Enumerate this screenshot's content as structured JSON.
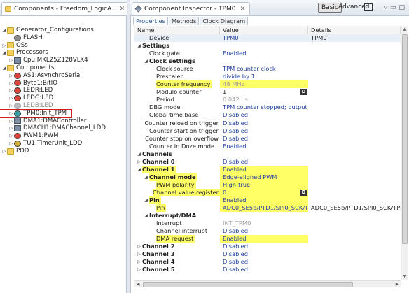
{
  "left": {
    "tab_title": "Components - Freedom_LogicA...",
    "tab_close": "✕",
    "win_buttons": [
      "▭",
      "□"
    ],
    "tree": [
      {
        "level": 0,
        "twisty": "◢",
        "icon": "folder",
        "label": "Generator_Configurations",
        "name": "tree-item-generator-configurations"
      },
      {
        "level": 1,
        "twisty": "",
        "icon": "gear-s",
        "label": "FLASH",
        "name": "tree-item-flash"
      },
      {
        "level": 0,
        "twisty": "▷",
        "icon": "folder",
        "label": "OSs",
        "name": "tree-item-oss"
      },
      {
        "level": 0,
        "twisty": "◢",
        "icon": "folder",
        "label": "Processors",
        "name": "tree-item-processors"
      },
      {
        "level": 1,
        "twisty": "▷",
        "icon": "chip",
        "label": "Cpu:MKL25Z128VLK4",
        "name": "tree-item-cpu"
      },
      {
        "level": 0,
        "twisty": "◢",
        "icon": "folder",
        "label": "Components",
        "name": "tree-item-components"
      },
      {
        "level": 1,
        "twisty": "▷",
        "icon": "cog-red",
        "label": "AS1:AsynchroSerial",
        "name": "tree-item-as1"
      },
      {
        "level": 1,
        "twisty": "▷",
        "icon": "cog-red",
        "label": "Byte1:BitIO",
        "name": "tree-item-byte1"
      },
      {
        "level": 1,
        "twisty": "▷",
        "icon": "cog-red",
        "label": "LEDR:LED",
        "name": "tree-item-ledr"
      },
      {
        "level": 1,
        "twisty": "▷",
        "icon": "cog-red",
        "label": "LEDG:LED",
        "name": "tree-item-ledg"
      },
      {
        "level": 1,
        "twisty": "▷",
        "icon": "cog-gray",
        "label": "LEDB:LED",
        "name": "tree-item-ledb",
        "dim": true
      },
      {
        "level": 1,
        "twisty": "▷",
        "icon": "cog-teal",
        "label": "TPM0:Init_TPM",
        "name": "tree-item-tpm0",
        "selected": true
      },
      {
        "level": 1,
        "twisty": "▷",
        "icon": "chip",
        "label": "DMA1:DMAController",
        "name": "tree-item-dma1"
      },
      {
        "level": 1,
        "twisty": "▷",
        "icon": "chip",
        "label": "DMACH1:DMAChannel_LDD",
        "name": "tree-item-dmach1"
      },
      {
        "level": 1,
        "twisty": "▷",
        "icon": "cog-red",
        "label": "PWM1:PWM",
        "name": "tree-item-pwm1"
      },
      {
        "level": 1,
        "twisty": "▷",
        "icon": "cog-yellow",
        "label": "TU1:TimerUnit_LDD",
        "name": "tree-item-tu1"
      },
      {
        "level": 0,
        "twisty": "▷",
        "icon": "folder",
        "label": "PDD",
        "name": "tree-item-pdd"
      }
    ]
  },
  "right": {
    "tab_title": "Component Inspector - TPM0",
    "tab_close": "✕",
    "basic_label": "Basic",
    "advanced_label": "Advanced",
    "win_buttons": [
      "▿",
      "▭",
      "□"
    ],
    "prop_tabs": [
      "Properties",
      "Methods",
      "Clock Diagram"
    ],
    "columns": [
      "Name",
      "Value",
      "Details"
    ],
    "rows": [
      {
        "i": 1,
        "tri": "",
        "name": "Device",
        "value": "TPM0",
        "details": "TPM0",
        "selected": true
      },
      {
        "i": 0,
        "tri": "◢",
        "name": "Settings",
        "value": "",
        "details": "",
        "bold": true
      },
      {
        "i": 1,
        "tri": "",
        "name": "Clock gate",
        "value": "Enabled",
        "details": ""
      },
      {
        "i": 1,
        "tri": "◢",
        "name": "Clock settings",
        "value": "",
        "details": "",
        "bold": true
      },
      {
        "i": 2,
        "tri": "",
        "name": "Clock source",
        "value": "TPM counter clock",
        "details": ""
      },
      {
        "i": 2,
        "tri": "",
        "name": "Prescaler",
        "value": "divide by 1",
        "details": ""
      },
      {
        "i": 2,
        "tri": "",
        "name": "Counter frequency",
        "value": "48 MHz",
        "details": "",
        "hl": true,
        "gray": true
      },
      {
        "i": 2,
        "tri": "",
        "name": "Modulo counter",
        "value": "1",
        "details": "",
        "dbtn": true,
        "dark": true
      },
      {
        "i": 2,
        "tri": "",
        "name": "Period",
        "value": "0.042 us",
        "details": "",
        "gray": true
      },
      {
        "i": 1,
        "tri": "",
        "name": "DBG mode",
        "value": "TPM counter stopped; output pins ...",
        "details": ""
      },
      {
        "i": 1,
        "tri": "",
        "name": "Global time base",
        "value": "Disabled",
        "details": ""
      },
      {
        "i": 1,
        "tri": "",
        "name": "Counter reload on trigger",
        "value": "Disabled",
        "details": ""
      },
      {
        "i": 1,
        "tri": "",
        "name": "Counter start on trigger",
        "value": "Disabled",
        "details": ""
      },
      {
        "i": 1,
        "tri": "",
        "name": "Counter stop on overflow",
        "value": "Disabled",
        "details": ""
      },
      {
        "i": 1,
        "tri": "",
        "name": "Counter in Doze mode",
        "value": "Enabled",
        "details": ""
      },
      {
        "i": 0,
        "tri": "◢",
        "name": "Channels",
        "value": "",
        "details": "",
        "bold": true
      },
      {
        "i": 0,
        "tri": "▷",
        "name": "Channel 0",
        "value": "Disabled",
        "details": "",
        "bold": true
      },
      {
        "i": 0,
        "tri": "◢",
        "name": "Channel 1",
        "value": "Enabled",
        "details": "",
        "bold": true,
        "hl": true
      },
      {
        "i": 1,
        "tri": "◢",
        "name": "Channel mode",
        "value": "Edge-aligned PWM",
        "details": "",
        "bold": true,
        "hl": true
      },
      {
        "i": 2,
        "tri": "",
        "name": "PWM polarity",
        "value": "High-true",
        "details": "",
        "hl": true
      },
      {
        "i": 2,
        "tri": "",
        "name": "Channel value register",
        "value": "0",
        "details": "",
        "hl": true,
        "dbtn": true
      },
      {
        "i": 1,
        "tri": "◢",
        "name": "Pin",
        "value": "Enabled",
        "details": "",
        "bold": true,
        "hl": true
      },
      {
        "i": 2,
        "tri": "",
        "name": "Pin",
        "value": "ADC0_SE5b/PTD1/SPI0_SCK/TPM0_...",
        "details": "ADC0_SE5b/PTD1/SPI0_SCK/TPM0_...",
        "hl": true
      },
      {
        "i": 1,
        "tri": "◢",
        "name": "Interrupt/DMA",
        "value": "",
        "details": "",
        "bold": true
      },
      {
        "i": 2,
        "tri": "",
        "name": "Interrupt",
        "value": "INT_TPM0",
        "details": "",
        "gray": true
      },
      {
        "i": 2,
        "tri": "",
        "name": "Channel interrupt",
        "value": "Disabled",
        "details": ""
      },
      {
        "i": 2,
        "tri": "",
        "name": "DMA request",
        "value": "Enabled",
        "details": "",
        "hl": true
      },
      {
        "i": 0,
        "tri": "▷",
        "name": "Channel 2",
        "value": "Disabled",
        "details": "",
        "bold": true
      },
      {
        "i": 0,
        "tri": "▷",
        "name": "Channel 3",
        "value": "Disabled",
        "details": "",
        "bold": true
      },
      {
        "i": 0,
        "tri": "▷",
        "name": "Channel 4",
        "value": "Disabled",
        "details": "",
        "bold": true
      },
      {
        "i": 0,
        "tri": "▷",
        "name": "Channel 5",
        "value": "Disabled",
        "details": "",
        "bold": true
      }
    ]
  }
}
